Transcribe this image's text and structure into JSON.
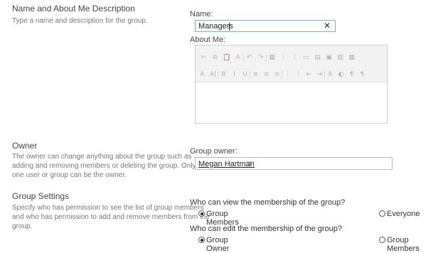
{
  "name_section": {
    "title": "Name and About Me Description",
    "description": "Type a name and description for the group.",
    "name_label": "Name:",
    "name_value": "Managers",
    "clear_icon": "✕",
    "about_label": "About Me:",
    "toolbar_row1": [
      "✂",
      "⧉",
      "📋",
      "A",
      "↶",
      "↷",
      "▦",
      "⁝",
      "⁞",
      "▭",
      "▤",
      "▣",
      "▥",
      "▦"
    ],
    "toolbar_row2": [
      "A",
      "A|",
      "B",
      "I",
      "U",
      "≡",
      "≡",
      "≡",
      "⋮",
      "⋮",
      "⇤",
      "⇥",
      "A",
      "◐",
      "¶",
      "¶"
    ]
  },
  "owner_section": {
    "title": "Owner",
    "description_lines": [
      "The owner can change anything about the group such as",
      "adding and removing members or deleting the group. Only",
      "one user or group can be the owner."
    ],
    "owner_label": "Group owner:",
    "owner_value": "Megan Hartman",
    "remove_icon": "x"
  },
  "settings_section": {
    "title": "Group Settings",
    "description_lines": [
      "Specify who has permission to see the list of group members",
      "and who has permission to add and remove members from the",
      "group."
    ],
    "view_question": "Who can view the membership of the group?",
    "view_options": [
      {
        "label": "Group Members",
        "selected": true
      },
      {
        "label": "Everyone",
        "selected": false
      }
    ],
    "edit_question": "Who can edit the membership of the group?",
    "edit_options": [
      {
        "label": "Group Owner",
        "selected": true
      },
      {
        "label": "Group Members",
        "selected": false
      }
    ]
  }
}
